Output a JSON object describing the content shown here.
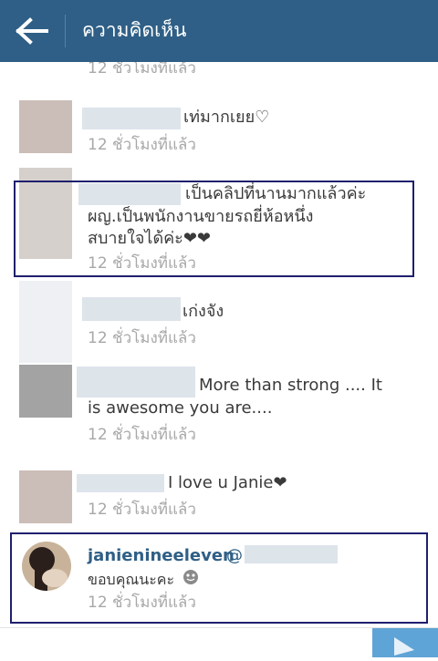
{
  "header": {
    "title": "ความคิดเห็น",
    "back_icon": "arrow-left-icon",
    "background": "#2f5f86"
  },
  "comments": [
    {
      "text": "",
      "time": "12 ชั่วโมงที่แล้ว"
    },
    {
      "text": "เท่มากเยย♡",
      "time": "12 ชั่วโมงที่แล้ว"
    },
    {
      "line1": "เป็นคลิปที่นานมากแล้วค่ะ",
      "line2": "ผญ.เป็นพนักงานขายรถยี่ห้อหนึ่ง",
      "line3": "สบายใจได้ค่ะ❤❤",
      "time": "12 ชั่วโมงที่แล้ว"
    },
    {
      "text": "เก่งจัง",
      "time": "12 ชั่วโมงที่แล้ว"
    },
    {
      "line1": "More than strong .... It",
      "line2": "is awesome you are....",
      "time": "12 ชั่วโมงที่แล้ว"
    },
    {
      "text": "I love u Janie❤",
      "time": "12 ชั่วโมงที่แล้ว"
    },
    {
      "username": "janienineeleven",
      "mention_prefix": "@",
      "text": "ขอบคุณนะคะ",
      "time": "12 ชั่วโมงที่แล้ว"
    }
  ],
  "colors": {
    "highlight_border": "#1f1f6e",
    "username": "#2f5f86",
    "send_button": "#5fa4d6"
  }
}
